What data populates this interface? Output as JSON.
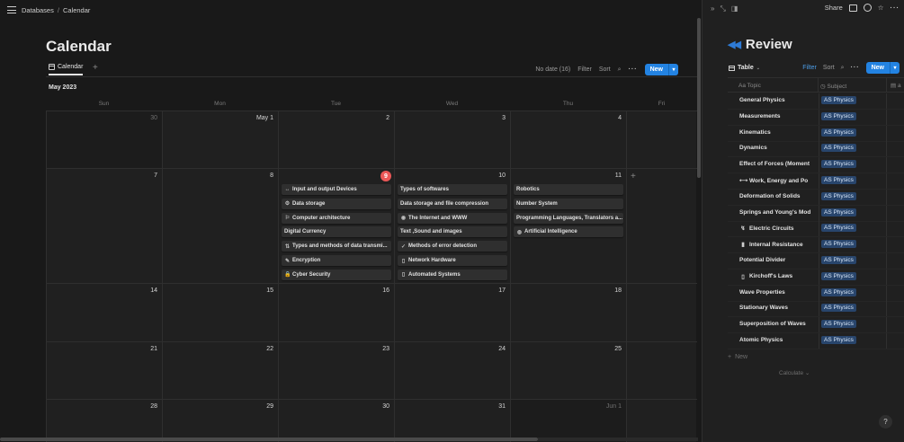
{
  "breadcrumb": {
    "root": "Databases",
    "current": "Calendar"
  },
  "calendar": {
    "title": "Calendar",
    "view_tab": "Calendar",
    "toolbar": {
      "no_date": "No date (16)",
      "filter": "Filter",
      "sort": "Sort",
      "new": "New"
    },
    "month": "May 2023",
    "days_of_week": [
      "Sun",
      "Mon",
      "Tue",
      "Wed",
      "Thu",
      "Fri"
    ],
    "weeks": [
      {
        "days": [
          {
            "label": "30",
            "out": true
          },
          {
            "label": "May 1",
            "out": false
          },
          {
            "label": "2",
            "out": false
          },
          {
            "label": "3",
            "out": false
          },
          {
            "label": "4",
            "out": false
          },
          {
            "label": "",
            "out": false
          }
        ]
      },
      {
        "days": [
          {
            "label": "7",
            "out": false
          },
          {
            "label": "8",
            "out": false
          },
          {
            "label": "9",
            "out": false,
            "today": true
          },
          {
            "label": "10",
            "out": false
          },
          {
            "label": "11",
            "out": false
          },
          {
            "label": "",
            "out": false
          }
        ]
      },
      {
        "days": [
          {
            "label": "14",
            "out": false
          },
          {
            "label": "15",
            "out": false
          },
          {
            "label": "16",
            "out": false
          },
          {
            "label": "17",
            "out": false
          },
          {
            "label": "18",
            "out": false
          },
          {
            "label": "",
            "out": false
          }
        ]
      },
      {
        "days": [
          {
            "label": "21",
            "out": false
          },
          {
            "label": "22",
            "out": false
          },
          {
            "label": "23",
            "out": false
          },
          {
            "label": "24",
            "out": false
          },
          {
            "label": "25",
            "out": false
          },
          {
            "label": "",
            "out": false
          }
        ]
      },
      {
        "days": [
          {
            "label": "28",
            "out": false
          },
          {
            "label": "29",
            "out": false
          },
          {
            "label": "30",
            "out": false
          },
          {
            "label": "31",
            "out": false
          },
          {
            "label": "Jun 1",
            "out": true
          },
          {
            "label": "",
            "out": false
          }
        ]
      }
    ],
    "events": {
      "tue": [
        {
          "title": "Input and output Devices",
          "icon": "↔"
        },
        {
          "title": "Data storage",
          "icon": "⚙"
        },
        {
          "title": "Computer architecture",
          "icon": "⚐"
        },
        {
          "title": "Digital Currency",
          "icon": ""
        },
        {
          "title": "Types and methods of data transmi...",
          "icon": "⇅"
        },
        {
          "title": "Encryption",
          "icon": "✎"
        },
        {
          "title": "Cyber Security",
          "icon": "🔒"
        }
      ],
      "wed": [
        {
          "title": "Types of softwares",
          "icon": ""
        },
        {
          "title": "Data storage and file compression",
          "icon": ""
        },
        {
          "title": "The Internet and WWW",
          "icon": "◉"
        },
        {
          "title": "Text ,Sound and images",
          "icon": ""
        },
        {
          "title": "Methods of error detection",
          "icon": "✓"
        },
        {
          "title": "Network Hardware",
          "icon": "▯"
        },
        {
          "title": "Automated Systems",
          "icon": "▯"
        }
      ],
      "thu": [
        {
          "title": "Robotics",
          "icon": ""
        },
        {
          "title": "Number System",
          "icon": ""
        },
        {
          "title": "Programming Languages, Translators a...",
          "icon": ""
        },
        {
          "title": "Artificial Intelligence",
          "icon": "◍"
        }
      ]
    }
  },
  "review": {
    "title": "Review",
    "share": "Share",
    "view_tab": "Table",
    "toolbar": {
      "filter": "Filter",
      "sort": "Sort",
      "new": "New"
    },
    "columns": {
      "topic": "Aa Topic",
      "subject": "Subject"
    },
    "rows": [
      {
        "topic": "General Physics",
        "icon": "",
        "subject": "AS Physics"
      },
      {
        "topic": "Measurements",
        "icon": "",
        "subject": "AS Physics"
      },
      {
        "topic": "Kinematics",
        "icon": "",
        "subject": "AS Physics"
      },
      {
        "topic": "Dynamics",
        "icon": "",
        "subject": "AS Physics"
      },
      {
        "topic": "Effect of Forces (Moment",
        "icon": "",
        "subject": "AS Physics"
      },
      {
        "topic": "Work, Energy and Po",
        "icon": "⟷",
        "subject": "AS Physics"
      },
      {
        "topic": "Deformation of Solids",
        "icon": "",
        "subject": "AS Physics"
      },
      {
        "topic": "Springs and Young's Mod",
        "icon": "",
        "subject": "AS Physics"
      },
      {
        "topic": "Electric Circuits",
        "icon": "↯",
        "subject": "AS Physics"
      },
      {
        "topic": "Internal Resistance",
        "icon": "▮",
        "subject": "AS Physics"
      },
      {
        "topic": "Potential Divider",
        "icon": "",
        "subject": "AS Physics"
      },
      {
        "topic": "Kirchoff's Laws",
        "icon": "▯",
        "subject": "AS Physics"
      },
      {
        "topic": "Wave Properties",
        "icon": "",
        "subject": "AS Physics"
      },
      {
        "topic": "Stationary Waves",
        "icon": "",
        "subject": "AS Physics"
      },
      {
        "topic": "Superposition of Waves",
        "icon": "",
        "subject": "AS Physics"
      },
      {
        "topic": "Atomic Physics",
        "icon": "",
        "subject": "AS Physics"
      }
    ],
    "new_row": "New",
    "calculate": "Calculate",
    "help": "?"
  },
  "colors": {
    "accent": "#2383e2",
    "today": "#eb5757",
    "tag_bg": "#28456c",
    "rewind": "#2e7bd6"
  }
}
